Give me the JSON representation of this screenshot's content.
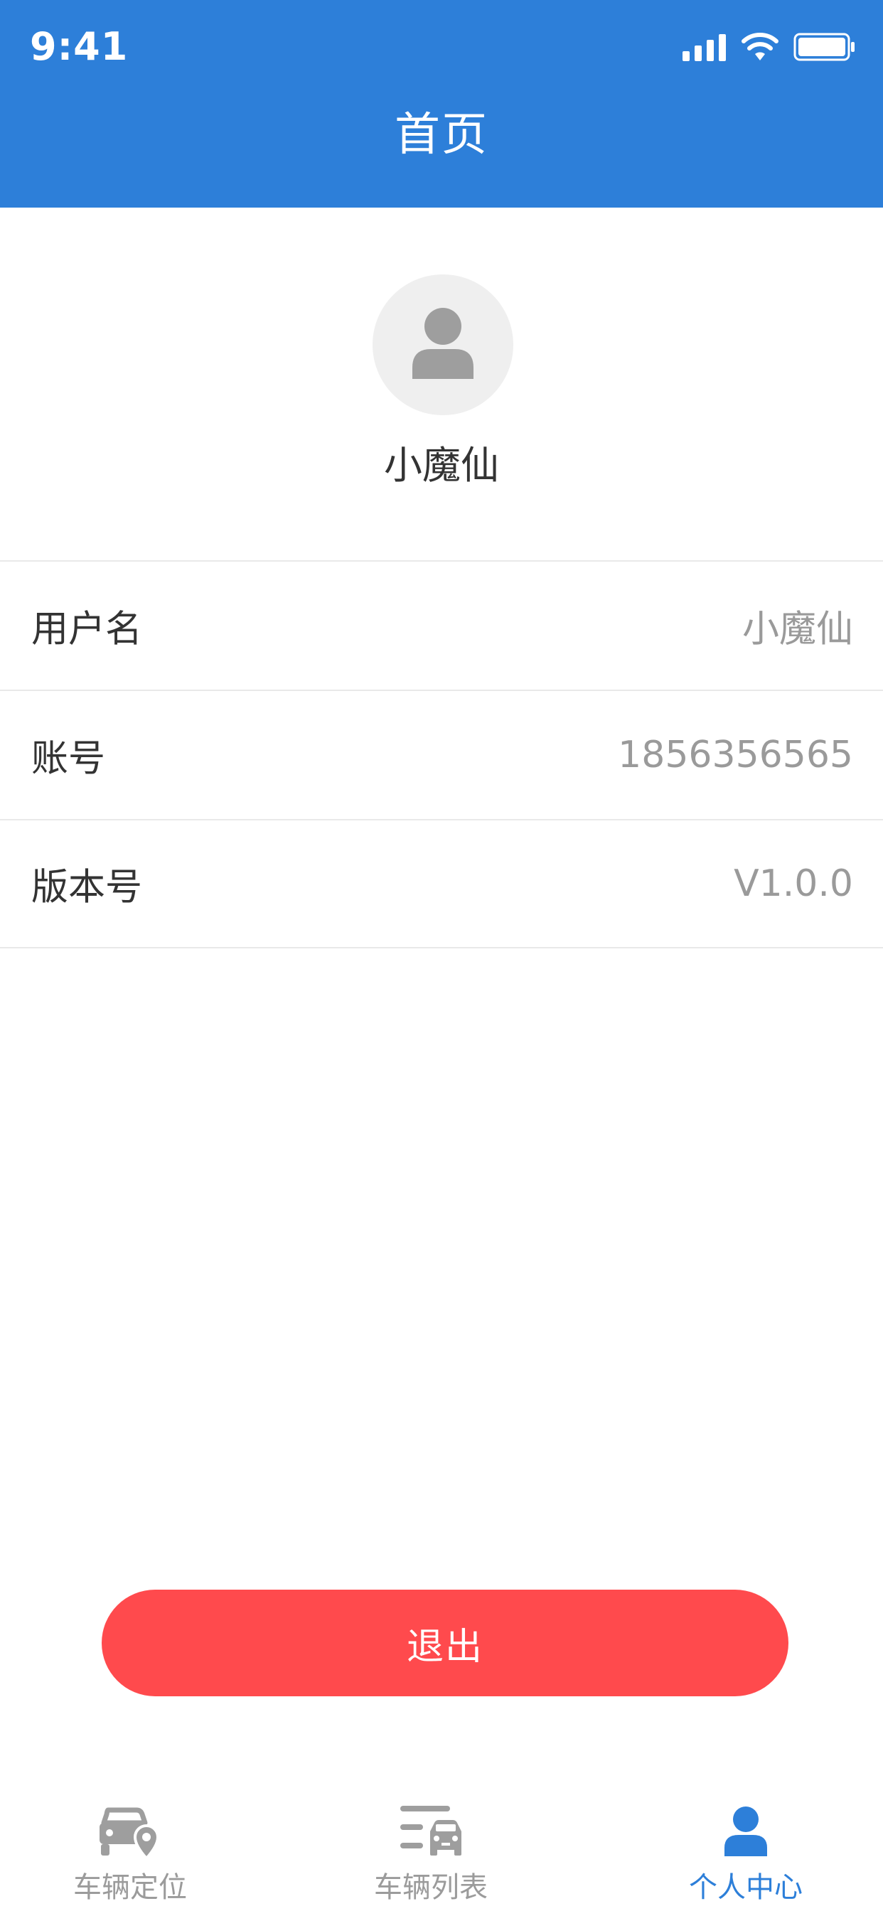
{
  "status_bar": {
    "time": "9:41"
  },
  "header": {
    "title": "首页"
  },
  "profile": {
    "name": "小魔仙"
  },
  "info": [
    {
      "label": "用户名",
      "value": "小魔仙"
    },
    {
      "label": "账号",
      "value": "1856356565"
    },
    {
      "label": "版本号",
      "value": "V1.0.0"
    }
  ],
  "logout": {
    "label": "退出"
  },
  "tabbar": {
    "items": [
      {
        "label": "车辆定位",
        "icon": "car-location-icon",
        "active": false
      },
      {
        "label": "车辆列表",
        "icon": "car-list-icon",
        "active": false
      },
      {
        "label": "个人中心",
        "icon": "person-icon",
        "active": true
      }
    ]
  },
  "colors": {
    "primary": "#2d7fd9",
    "danger": "#ff4a4d",
    "text": "#333333",
    "muted": "#9a9a9a"
  }
}
